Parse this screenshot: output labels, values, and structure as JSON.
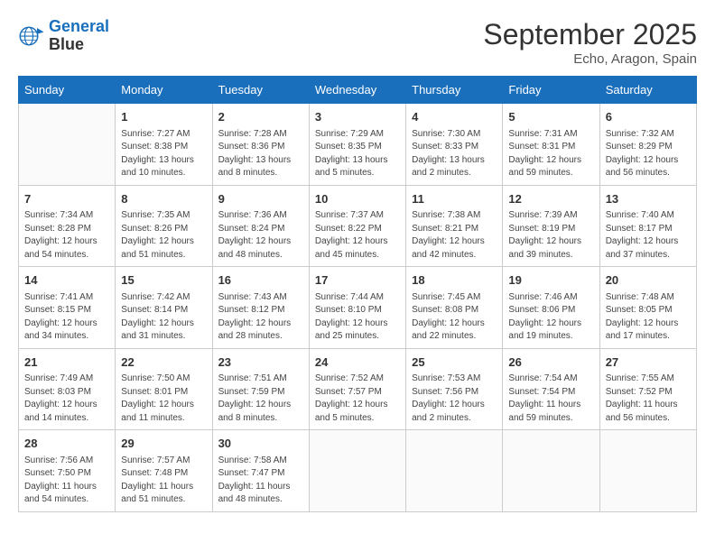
{
  "logo": {
    "line1": "General",
    "line2": "Blue"
  },
  "title": "September 2025",
  "location": "Echo, Aragon, Spain",
  "weekdays": [
    "Sunday",
    "Monday",
    "Tuesday",
    "Wednesday",
    "Thursday",
    "Friday",
    "Saturday"
  ],
  "weeks": [
    [
      {
        "day": "",
        "info": ""
      },
      {
        "day": "1",
        "info": "Sunrise: 7:27 AM\nSunset: 8:38 PM\nDaylight: 13 hours\nand 10 minutes."
      },
      {
        "day": "2",
        "info": "Sunrise: 7:28 AM\nSunset: 8:36 PM\nDaylight: 13 hours\nand 8 minutes."
      },
      {
        "day": "3",
        "info": "Sunrise: 7:29 AM\nSunset: 8:35 PM\nDaylight: 13 hours\nand 5 minutes."
      },
      {
        "day": "4",
        "info": "Sunrise: 7:30 AM\nSunset: 8:33 PM\nDaylight: 13 hours\nand 2 minutes."
      },
      {
        "day": "5",
        "info": "Sunrise: 7:31 AM\nSunset: 8:31 PM\nDaylight: 12 hours\nand 59 minutes."
      },
      {
        "day": "6",
        "info": "Sunrise: 7:32 AM\nSunset: 8:29 PM\nDaylight: 12 hours\nand 56 minutes."
      }
    ],
    [
      {
        "day": "7",
        "info": "Sunrise: 7:34 AM\nSunset: 8:28 PM\nDaylight: 12 hours\nand 54 minutes."
      },
      {
        "day": "8",
        "info": "Sunrise: 7:35 AM\nSunset: 8:26 PM\nDaylight: 12 hours\nand 51 minutes."
      },
      {
        "day": "9",
        "info": "Sunrise: 7:36 AM\nSunset: 8:24 PM\nDaylight: 12 hours\nand 48 minutes."
      },
      {
        "day": "10",
        "info": "Sunrise: 7:37 AM\nSunset: 8:22 PM\nDaylight: 12 hours\nand 45 minutes."
      },
      {
        "day": "11",
        "info": "Sunrise: 7:38 AM\nSunset: 8:21 PM\nDaylight: 12 hours\nand 42 minutes."
      },
      {
        "day": "12",
        "info": "Sunrise: 7:39 AM\nSunset: 8:19 PM\nDaylight: 12 hours\nand 39 minutes."
      },
      {
        "day": "13",
        "info": "Sunrise: 7:40 AM\nSunset: 8:17 PM\nDaylight: 12 hours\nand 37 minutes."
      }
    ],
    [
      {
        "day": "14",
        "info": "Sunrise: 7:41 AM\nSunset: 8:15 PM\nDaylight: 12 hours\nand 34 minutes."
      },
      {
        "day": "15",
        "info": "Sunrise: 7:42 AM\nSunset: 8:14 PM\nDaylight: 12 hours\nand 31 minutes."
      },
      {
        "day": "16",
        "info": "Sunrise: 7:43 AM\nSunset: 8:12 PM\nDaylight: 12 hours\nand 28 minutes."
      },
      {
        "day": "17",
        "info": "Sunrise: 7:44 AM\nSunset: 8:10 PM\nDaylight: 12 hours\nand 25 minutes."
      },
      {
        "day": "18",
        "info": "Sunrise: 7:45 AM\nSunset: 8:08 PM\nDaylight: 12 hours\nand 22 minutes."
      },
      {
        "day": "19",
        "info": "Sunrise: 7:46 AM\nSunset: 8:06 PM\nDaylight: 12 hours\nand 19 minutes."
      },
      {
        "day": "20",
        "info": "Sunrise: 7:48 AM\nSunset: 8:05 PM\nDaylight: 12 hours\nand 17 minutes."
      }
    ],
    [
      {
        "day": "21",
        "info": "Sunrise: 7:49 AM\nSunset: 8:03 PM\nDaylight: 12 hours\nand 14 minutes."
      },
      {
        "day": "22",
        "info": "Sunrise: 7:50 AM\nSunset: 8:01 PM\nDaylight: 12 hours\nand 11 minutes."
      },
      {
        "day": "23",
        "info": "Sunrise: 7:51 AM\nSunset: 7:59 PM\nDaylight: 12 hours\nand 8 minutes."
      },
      {
        "day": "24",
        "info": "Sunrise: 7:52 AM\nSunset: 7:57 PM\nDaylight: 12 hours\nand 5 minutes."
      },
      {
        "day": "25",
        "info": "Sunrise: 7:53 AM\nSunset: 7:56 PM\nDaylight: 12 hours\nand 2 minutes."
      },
      {
        "day": "26",
        "info": "Sunrise: 7:54 AM\nSunset: 7:54 PM\nDaylight: 11 hours\nand 59 minutes."
      },
      {
        "day": "27",
        "info": "Sunrise: 7:55 AM\nSunset: 7:52 PM\nDaylight: 11 hours\nand 56 minutes."
      }
    ],
    [
      {
        "day": "28",
        "info": "Sunrise: 7:56 AM\nSunset: 7:50 PM\nDaylight: 11 hours\nand 54 minutes."
      },
      {
        "day": "29",
        "info": "Sunrise: 7:57 AM\nSunset: 7:48 PM\nDaylight: 11 hours\nand 51 minutes."
      },
      {
        "day": "30",
        "info": "Sunrise: 7:58 AM\nSunset: 7:47 PM\nDaylight: 11 hours\nand 48 minutes."
      },
      {
        "day": "",
        "info": ""
      },
      {
        "day": "",
        "info": ""
      },
      {
        "day": "",
        "info": ""
      },
      {
        "day": "",
        "info": ""
      }
    ]
  ]
}
